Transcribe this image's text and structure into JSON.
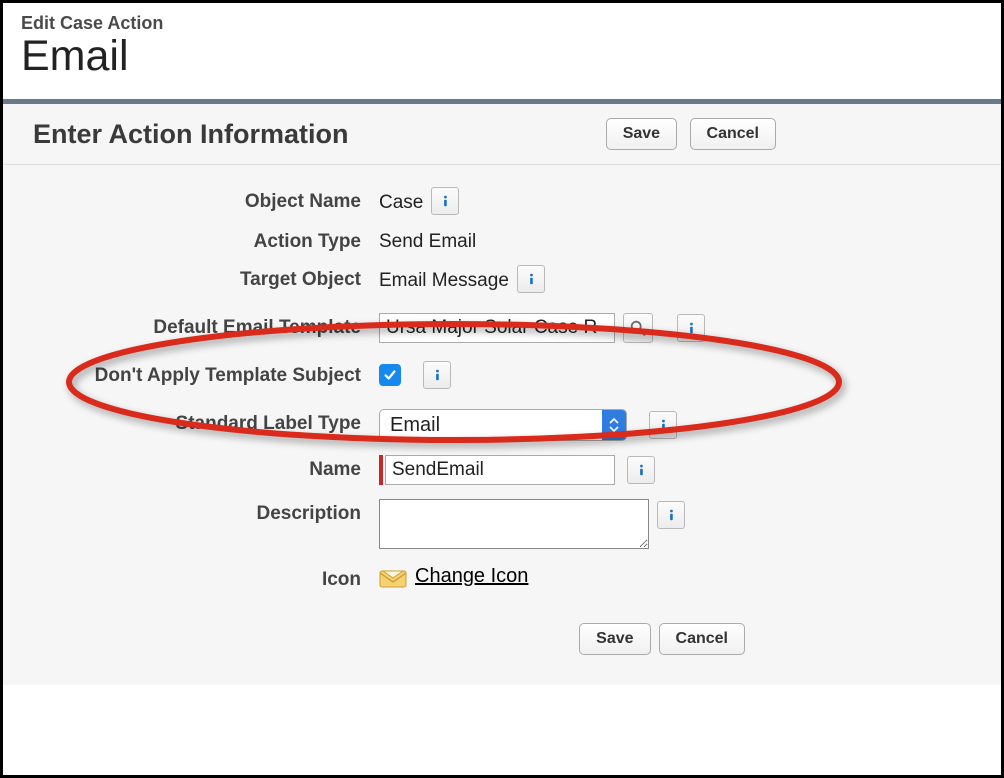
{
  "header": {
    "super_title": "Edit Case Action",
    "title": "Email"
  },
  "panel": {
    "title": "Enter Action Information",
    "save_label": "Save",
    "cancel_label": "Cancel"
  },
  "form": {
    "object_name": {
      "label": "Object Name",
      "value": "Case"
    },
    "action_type": {
      "label": "Action Type",
      "value": "Send Email"
    },
    "target_object": {
      "label": "Target Object",
      "value": "Email Message"
    },
    "default_email_template": {
      "label": "Default Email Template",
      "value": "Ursa Major Solar Case R"
    },
    "dont_apply_template_subject": {
      "label": "Don't Apply Template Subject",
      "checked": true
    },
    "standard_label_type": {
      "label": "Standard Label Type",
      "value": "Email"
    },
    "name": {
      "label": "Name",
      "value": "SendEmail"
    },
    "description": {
      "label": "Description",
      "value": ""
    },
    "icon": {
      "label": "Icon",
      "change_label": "Change Icon"
    }
  },
  "footer": {
    "save_label": "Save",
    "cancel_label": "Cancel"
  }
}
